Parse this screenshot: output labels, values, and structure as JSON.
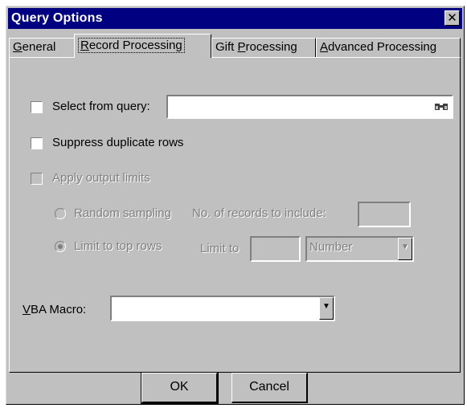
{
  "window": {
    "title": "Query Options",
    "close_glyph": "✕"
  },
  "tabs": [
    {
      "pre": "",
      "key": "G",
      "post": "eneral"
    },
    {
      "pre": "",
      "key": "R",
      "post": "ecord Processing"
    },
    {
      "pre": "Gift ",
      "key": "P",
      "post": "rocessing"
    },
    {
      "pre": "",
      "key": "A",
      "post": "dvanced Processing"
    }
  ],
  "record_processing": {
    "select_from_query": {
      "label": "Select from query:",
      "value": "",
      "checked": false,
      "browse_icon": "binoculars-icon"
    },
    "suppress_duplicates": {
      "label": "Suppress duplicate rows",
      "checked": false
    },
    "apply_output_limits": {
      "label": "Apply output limits",
      "checked": false,
      "enabled": false
    },
    "random_sampling": {
      "label": "Random sampling",
      "records_label": "No. of records to include:",
      "records_value": ""
    },
    "limit_top_rows": {
      "label": "Limit to top rows",
      "limit_label": "Limit to",
      "limit_value": "",
      "unit_selected": "Number",
      "selected": true
    },
    "vba_macro": {
      "key": "V",
      "label_rest": "BA Macro:",
      "value": ""
    }
  },
  "buttons": {
    "ok": "OK",
    "cancel": "Cancel"
  }
}
